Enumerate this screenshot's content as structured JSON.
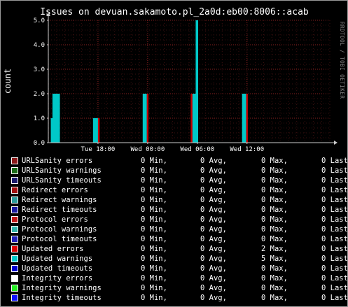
{
  "chart_data": {
    "type": "area",
    "title": "Issues on devuan.sakamoto.pl_2a0d:eb00:8006::acab",
    "ylabel": "count",
    "xlabel": "",
    "ylim": [
      0,
      5
    ],
    "xlim": [
      0,
      34
    ],
    "yticks": [
      "0.0",
      "1.0",
      "2.0",
      "3.0",
      "4.0",
      "5.0"
    ],
    "xticks": [
      {
        "label": "Tue 18:00",
        "x": 6
      },
      {
        "label": "Wed 00:00",
        "x": 12
      },
      {
        "label": "Wed 06:00",
        "x": 18
      },
      {
        "label": "Wed 12:00",
        "x": 24
      }
    ],
    "grid": true,
    "side_label": "RRDTOOL / TOBI OETIKER",
    "series": [
      {
        "name": "Updated warnings",
        "color": "#00c8c8",
        "points": [
          [
            0.3,
            0
          ],
          [
            0.3,
            1
          ],
          [
            0.5,
            1
          ],
          [
            0.5,
            2
          ],
          [
            1.4,
            2
          ],
          [
            1.4,
            0
          ],
          [
            5.4,
            0
          ],
          [
            5.4,
            1
          ],
          [
            6.0,
            1
          ],
          [
            6.0,
            0
          ],
          [
            11.4,
            0
          ],
          [
            11.4,
            2
          ],
          [
            11.9,
            2
          ],
          [
            11.9,
            0
          ],
          [
            17.4,
            0
          ],
          [
            17.4,
            2
          ],
          [
            17.8,
            2
          ],
          [
            17.8,
            5
          ],
          [
            18.1,
            5
          ],
          [
            18.1,
            0
          ],
          [
            23.4,
            0
          ],
          [
            23.4,
            2
          ],
          [
            23.9,
            2
          ],
          [
            23.9,
            0
          ]
        ]
      },
      {
        "name": "Updated errors",
        "color": "#c80000",
        "points": [
          [
            6.0,
            0
          ],
          [
            6.0,
            1
          ],
          [
            6.2,
            1
          ],
          [
            6.2,
            0
          ],
          [
            11.9,
            0
          ],
          [
            11.9,
            2
          ],
          [
            12.1,
            2
          ],
          [
            12.1,
            0
          ],
          [
            17.2,
            0
          ],
          [
            17.2,
            2
          ],
          [
            17.4,
            2
          ],
          [
            17.4,
            0
          ],
          [
            23.9,
            0
          ],
          [
            23.9,
            2
          ],
          [
            24.1,
            2
          ],
          [
            24.1,
            0
          ]
        ]
      }
    ],
    "legend": [
      {
        "name": "URLSanity errors",
        "color": "#8b1a1a",
        "min": "0 Min,",
        "avg": "0 Avg,",
        "max": "0 Max,",
        "last": "0 Last"
      },
      {
        "name": "URLSanity warnings",
        "color": "#1a6b1a",
        "min": "0 Min,",
        "avg": "0 Avg,",
        "max": "0 Max,",
        "last": "0 Last"
      },
      {
        "name": "URLSanity timeouts",
        "color": "#1a1a6b",
        "min": "0 Min,",
        "avg": "0 Avg,",
        "max": "0 Max,",
        "last": "0 Last"
      },
      {
        "name": "Redirect errors",
        "color": "#a01010",
        "min": "0 Min,",
        "avg": "0 Avg,",
        "max": "0 Max,",
        "last": "0 Last"
      },
      {
        "name": "Redirect warnings",
        "color": "#2a9a9a",
        "min": "0 Min,",
        "avg": "0 Avg,",
        "max": "0 Max,",
        "last": "0 Last"
      },
      {
        "name": "Redirect timeouts",
        "color": "#1a1aa0",
        "min": "0 Min,",
        "avg": "0 Avg,",
        "max": "0 Max,",
        "last": "0 Last"
      },
      {
        "name": "Protocol errors",
        "color": "#c01818",
        "min": "0 Min,",
        "avg": "0 Avg,",
        "max": "0 Max,",
        "last": "0 Last"
      },
      {
        "name": "Protocol warnings",
        "color": "#30b0a8",
        "min": "0 Min,",
        "avg": "0 Avg,",
        "max": "0 Max,",
        "last": "0 Last"
      },
      {
        "name": "Protocol timeouts",
        "color": "#2020b8",
        "min": "0 Min,",
        "avg": "0 Avg,",
        "max": "0 Max,",
        "last": "0 Last"
      },
      {
        "name": "Updated errors",
        "color": "#dd0000",
        "min": "0 Min,",
        "avg": "0 Avg,",
        "max": "2 Max,",
        "last": "0 Last"
      },
      {
        "name": "Updated warnings",
        "color": "#00c8c8",
        "min": "0 Min,",
        "avg": "0 Avg,",
        "max": "5 Max,",
        "last": "0 Last"
      },
      {
        "name": "Updated timeouts",
        "color": "#0000d0",
        "min": "0 Min,",
        "avg": "0 Avg,",
        "max": "0 Max,",
        "last": "0 Last"
      },
      {
        "name": "Integrity errors",
        "color": "#ffffff",
        "min": "0 Min,",
        "avg": "0 Avg,",
        "max": "0 Max,",
        "last": "0 Last"
      },
      {
        "name": "Integrity warnings",
        "color": "#22ee22",
        "min": "0 Min,",
        "avg": "0 Avg,",
        "max": "0 Max,",
        "last": "0 Last"
      },
      {
        "name": "Integrity timeouts",
        "color": "#1010ff",
        "min": "0 Min,",
        "avg": "0 Avg,",
        "max": "0 Max,",
        "last": "0 Last"
      }
    ]
  }
}
